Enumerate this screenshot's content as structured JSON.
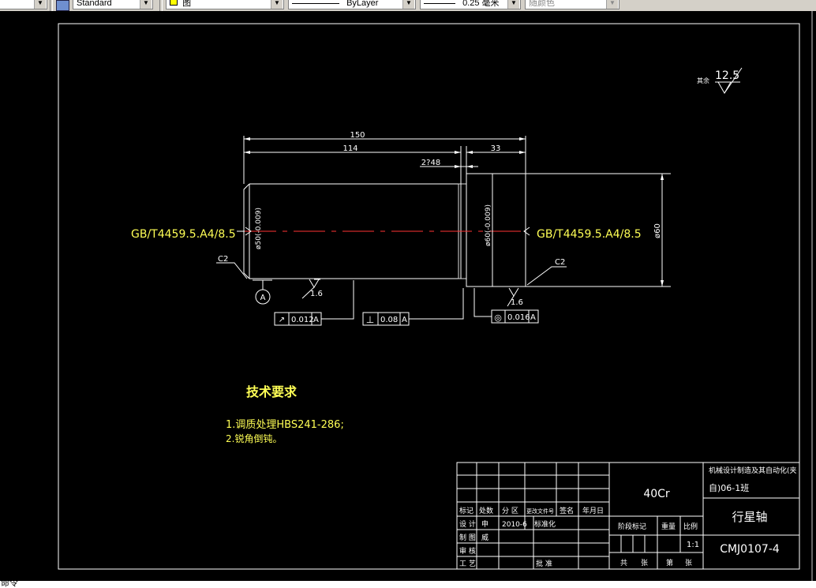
{
  "toolbar": {
    "style_combo": "Standard",
    "layer_combo": "图",
    "linetype_combo": "ByLayer",
    "lineweight_combo": "0.25 毫米",
    "color_combo": "随颜色"
  },
  "command_line": {
    "text": "命令"
  },
  "drawing": {
    "dims": {
      "overall_length": "150",
      "length_114": "114",
      "length_33": "33",
      "groove": "2?48",
      "dia_left": "ø50(-0.009)",
      "dia_mid": "ø60(-0.009)",
      "dia_right": "ø60"
    },
    "center_hole_left": "GB/T4459.5.A4/8.5",
    "center_hole_right": "GB/T4459.5.A4/8.5",
    "chamfer_left": "C2",
    "chamfer_right": "C2",
    "datum": "A",
    "roughness": {
      "rough_left": "1.6",
      "rough_right": "1.6",
      "rough_other": "12.5",
      "rough_other_label": "其余"
    },
    "tolerances": [
      {
        "symbol": "↗",
        "value": "0.012",
        "datum": "A"
      },
      {
        "symbol": "⊥",
        "value": "0.08",
        "datum": "A"
      },
      {
        "symbol": "◎",
        "value": "0.016",
        "datum": "A"
      }
    ],
    "tech_req": {
      "title": "技术要求",
      "item1": "1.调质处理HBS241-286;",
      "item2": "2.锐角倒钝。"
    }
  },
  "title_block": {
    "material": "40Cr",
    "part_name": "行星轴",
    "drawing_no": "CMJ0107-4",
    "project_line1": "机械设计制造及其自动化(夹",
    "project_line2": "自)06-1班",
    "scale": "1:1",
    "header_biaoji": "标记",
    "header_chushu": "处数",
    "header_fenqu": "分 区",
    "header_genggai": "更改文件号",
    "header_qianming": "签名",
    "header_nianyueri": "年月日",
    "row_sheji": "设 计",
    "row_sheji_name": "申",
    "row_sheji_date": "2010-6",
    "row_sheji_std": "标准化",
    "row_zhitu": "制 图",
    "row_zhitu_name": "威",
    "row_shenhe": "审 核",
    "row_gongyi": "工 艺",
    "row_pizhun": "批 准",
    "jieduan": "阶段标记",
    "zhongliang": "重量",
    "bili": "比例",
    "gong": "共",
    "zhang1": "张",
    "di": "第",
    "zhang2": "张"
  }
}
